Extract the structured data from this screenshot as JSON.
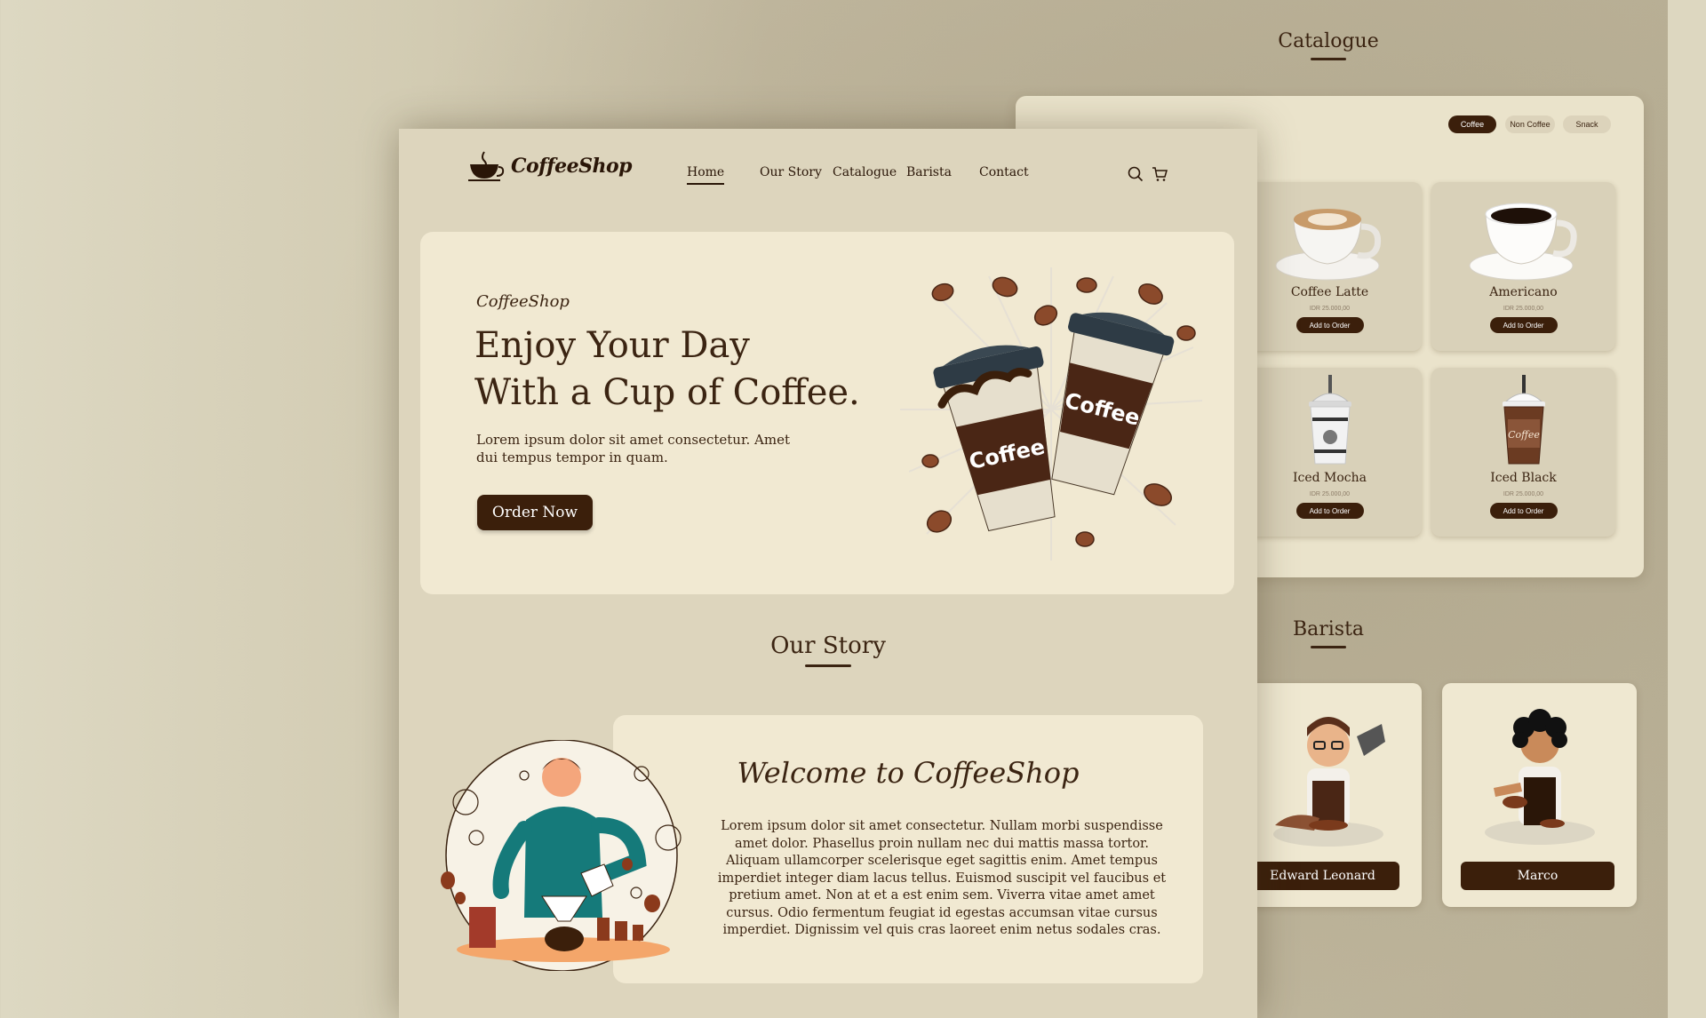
{
  "catalogue": {
    "title": "Catalogue",
    "filters": [
      "Coffee",
      "Non Coffee",
      "Snack"
    ],
    "active_filter": "Coffee",
    "products": [
      {
        "name": "Coffee Latte",
        "price": "IDR 25.000,00",
        "button": "Add to Order"
      },
      {
        "name": "Americano",
        "price": "IDR 25.000,00",
        "button": "Add to Order"
      },
      {
        "name": "Iced Mocha",
        "price": "IDR 25.000,00",
        "button": "Add to Order"
      },
      {
        "name": "Iced Black",
        "price": "IDR 25.000,00",
        "button": "Add to Order"
      }
    ]
  },
  "barista": {
    "title": "Barista",
    "people": [
      {
        "name": "Edward Leonard"
      },
      {
        "name": "Marco"
      }
    ]
  },
  "header": {
    "logo": "CoffeeShop",
    "nav": [
      "Home",
      "Our Story",
      "Catalogue",
      "Barista",
      "Contact"
    ],
    "active_nav": "Home",
    "icons": [
      "search-icon",
      "cart-icon"
    ]
  },
  "hero": {
    "brand": "CoffeeShop",
    "title_line1": "Enjoy Your Day",
    "title_line2": "With a Cup of Coffee.",
    "subtitle": "Lorem ipsum dolor sit amet consectetur. Amet dui tempus tempor in quam.",
    "button": "Order Now",
    "cup_label": "Coffee"
  },
  "story": {
    "title": "Our Story",
    "welcome": "Welcome to CoffeeShop",
    "text": "Lorem ipsum dolor sit amet consectetur. Nullam morbi suspendisse amet dolor. Phasellus proin nullam nec dui mattis massa tortor. Aliquam ullamcorper scelerisque eget sagittis enim. Amet tempus imperdiet integer diam lacus tellus. Euismod suscipit vel faucibus et pretium amet. Non at et a est enim sem. Viverra vitae amet amet cursus. Odio fermentum feugiat id egestas accumsan vitae cursus imperdiet. Dignissim vel quis cras laoreet enim netus sodales cras."
  },
  "colors": {
    "brand_dark": "#3b1f0b",
    "page_bg": "#ddd5bd",
    "card_bg": "#f1e9d2"
  }
}
